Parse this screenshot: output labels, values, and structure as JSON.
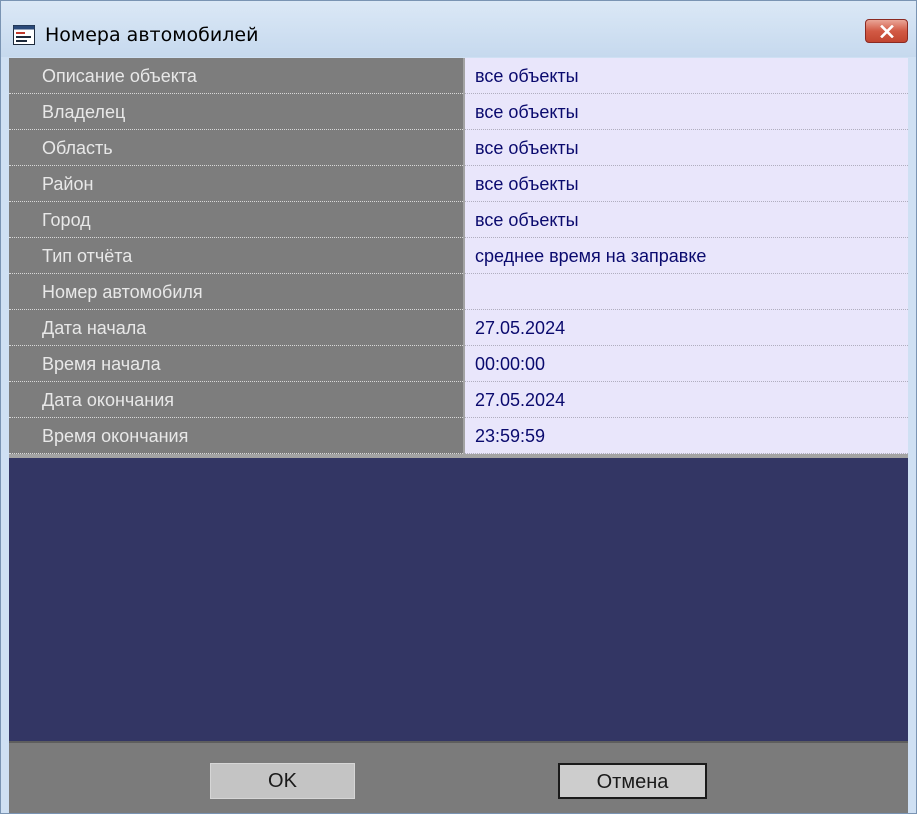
{
  "window": {
    "title": "Номера автомобилей",
    "icon": "form-window-icon",
    "close_icon": "close-x-icon"
  },
  "table": {
    "rows": [
      {
        "label": "Описание объекта",
        "value": "все объекты"
      },
      {
        "label": "Владелец",
        "value": "все объекты"
      },
      {
        "label": "Область",
        "value": "все объекты"
      },
      {
        "label": "Район",
        "value": "все объекты"
      },
      {
        "label": "Город",
        "value": "все объекты"
      },
      {
        "label": "Тип отчёта",
        "value": "среднее время на заправке"
      },
      {
        "label": "Номер автомобиля",
        "value": ""
      },
      {
        "label": "Дата начала",
        "value": "27.05.2024"
      },
      {
        "label": "Время начала",
        "value": "00:00:00"
      },
      {
        "label": "Дата окончания",
        "value": "27.05.2024"
      },
      {
        "label": "Время окончания",
        "value": "23:59:59"
      }
    ]
  },
  "buttons": {
    "ok_label": "OK",
    "cancel_label": "Отмена"
  },
  "colors": {
    "client_background": "#333664",
    "label_cell": "#7d7d7d",
    "value_cell": "#e9e6fb",
    "value_text": "#0a0a6e",
    "close_button": "#d25a45"
  }
}
